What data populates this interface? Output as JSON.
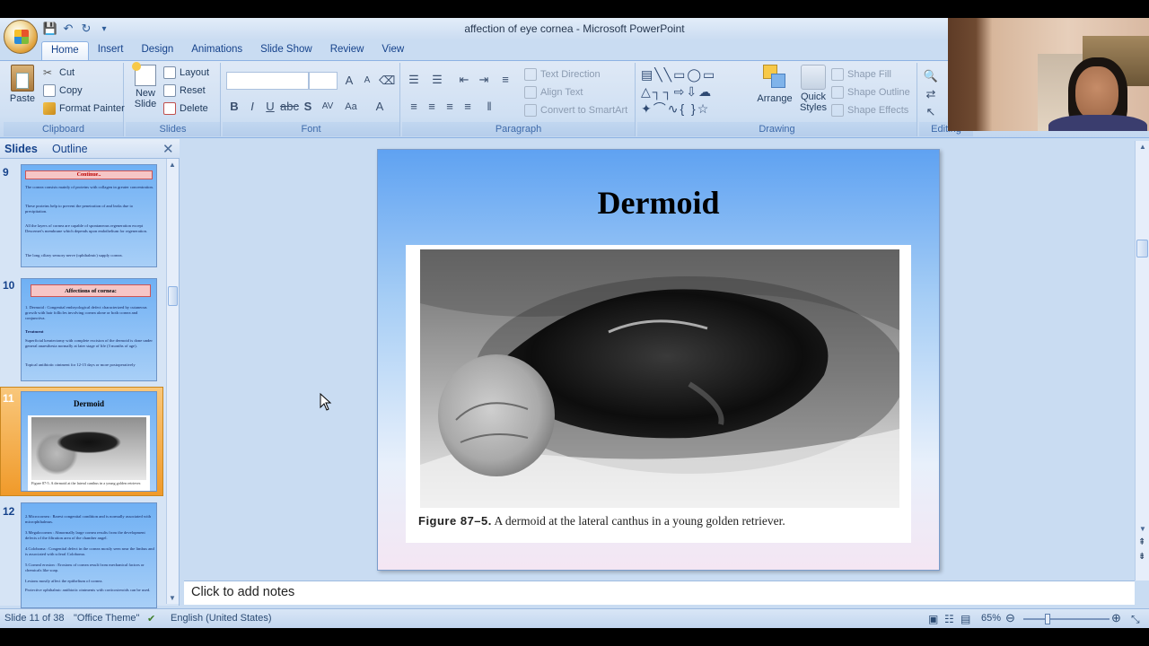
{
  "window": {
    "title": "affection of eye cornea - Microsoft PowerPoint"
  },
  "ribbon": {
    "tabs": [
      "Home",
      "Insert",
      "Design",
      "Animations",
      "Slide Show",
      "Review",
      "View"
    ],
    "active_tab": "Home",
    "clipboard": {
      "paste": "Paste",
      "cut": "Cut",
      "copy": "Copy",
      "format_painter": "Format Painter",
      "label": "Clipboard"
    },
    "slides": {
      "new_slide_1": "New",
      "new_slide_2": "Slide",
      "layout": "Layout",
      "reset": "Reset",
      "delete": "Delete",
      "label": "Slides"
    },
    "font": {
      "label": "Font"
    },
    "paragraph": {
      "text_direction": "Text Direction",
      "align_text": "Align Text",
      "convert_smartart": "Convert to SmartArt",
      "label": "Paragraph"
    },
    "drawing": {
      "arrange": "Arrange",
      "quick_styles_1": "Quick",
      "quick_styles_2": "Styles",
      "shape_fill": "Shape Fill",
      "shape_outline": "Shape Outline",
      "shape_effects": "Shape Effects",
      "label": "Drawing"
    },
    "editing": {
      "label": "Editing"
    }
  },
  "panel": {
    "tab_slides": "Slides",
    "tab_outline": "Outline",
    "thumbs": [
      {
        "num": "9",
        "title": "Continue..",
        "lines": [
          "The cornea consists mainly of proteins with collagen in greater concentration.",
          "These proteins help to prevent the penetration of and leaks due to precipitation.",
          "All the layers of cornea are capable of spontaneous regeneration except Descemet's membrane which depends upon endothelium for regeneration.",
          "The long ciliary sensory nerve (ophthalmic) supply cornea."
        ]
      },
      {
        "num": "10",
        "title": "Affections of cornea:",
        "lines": [
          "1. Dermoid : Congenital embryological defect characterized by cutaneous growth with hair follicles involving cornea alone or both cornea and conjunctiva.",
          "Treatment",
          "Superficial keratectomy with complete excision of the dermoid is done under general anaesthesia normally at later stage of life (3 months of age).",
          "Topical antibiotic ointment for 12-15 days or more postoperatively"
        ]
      },
      {
        "num": "11",
        "title": "Dermoid",
        "caption": "Figure 87-5. A dermoid at the lateral canthus in a young golden retriever."
      },
      {
        "num": "12",
        "lines": [
          "2.Microcornea : Rarest congenital condition and is normally associated with microphthalmus.",
          "3.Megalocornea : Abnormally large cornea results from the development defects of the filtration area of the chamber angel.",
          "4.Coloboma : Congenital defect in the cornea mostly seen near the limbus and is associated with scleral Coloboma.",
          "5.Corneal erosion : Erosions of cornea result from mechanical factors or chemicals like soap.",
          "Lesions mostly affect the epithelium of cornea.",
          "Protective ophthalmic antibiotic ointments with corticosteroids can be used."
        ]
      }
    ]
  },
  "slide": {
    "title": "Dermoid",
    "figure_label": "Figure 87–5.",
    "caption": "A dermoid at the lateral canthus in a young golden retriever."
  },
  "notes": {
    "placeholder": "Click to add notes"
  },
  "status": {
    "slide_counter": "Slide 11 of 38",
    "theme": "\"Office Theme\"",
    "language": "English (United States)",
    "zoom": "65%"
  }
}
